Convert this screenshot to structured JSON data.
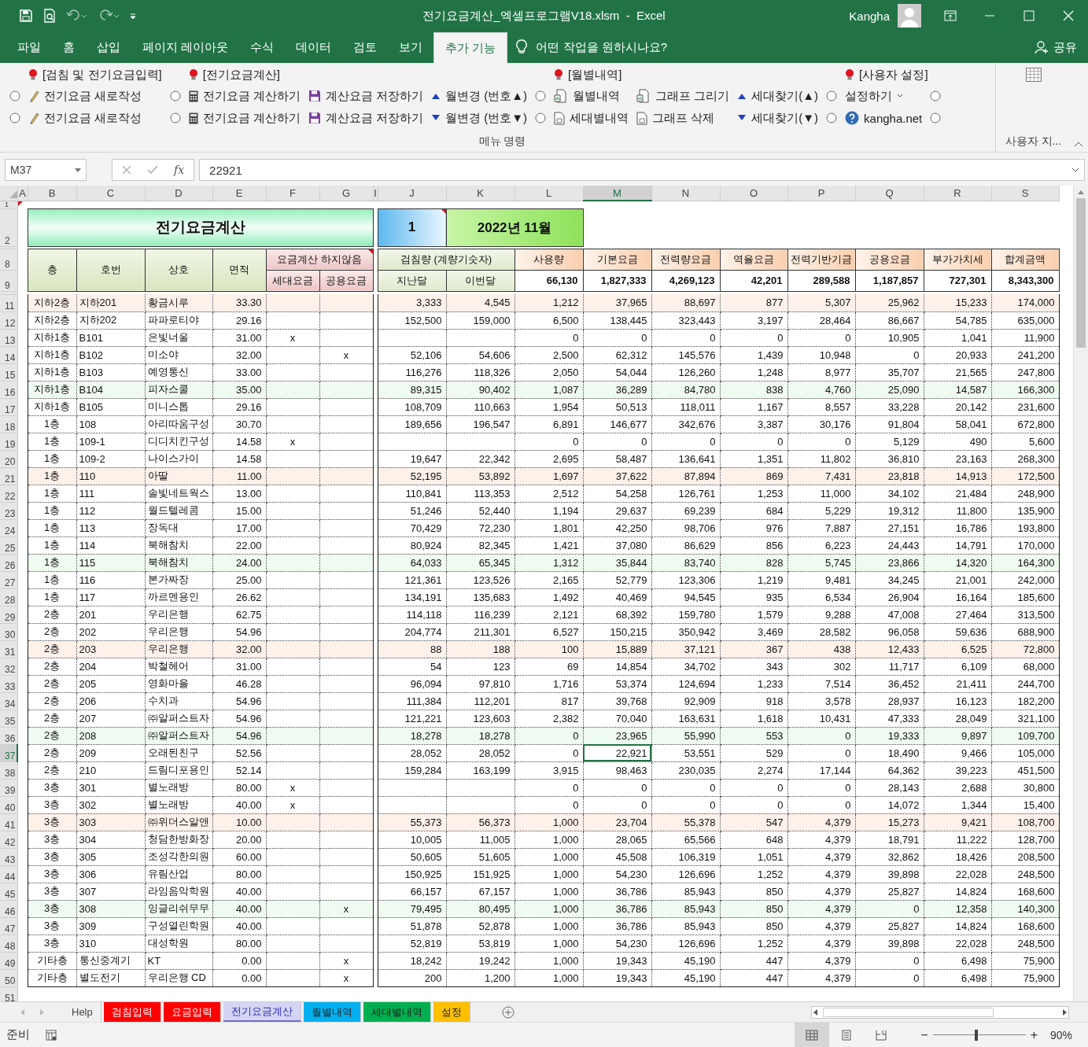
{
  "title_bar": {
    "title": "전기요금계산_엑셀프로그램V18.xlsm  -  Excel",
    "user": "Kangha"
  },
  "ribbon_tabs": [
    {
      "label": "파일",
      "selected": false
    },
    {
      "label": "홈",
      "selected": false
    },
    {
      "label": "삽입",
      "selected": false
    },
    {
      "label": "페이지 레이아웃",
      "selected": false
    },
    {
      "label": "수식",
      "selected": false
    },
    {
      "label": "데이터",
      "selected": false
    },
    {
      "label": "검토",
      "selected": false
    },
    {
      "label": "보기",
      "selected": false
    },
    {
      "label": "추가 기능",
      "selected": true
    }
  ],
  "tell_me": "어떤 작업을 원하시나요?",
  "share": "공유",
  "ribbon": {
    "group_label": "메뉴 명령",
    "sections": [
      {
        "heading": "[검침 및 전기요금입력]",
        "items": [
          {
            "kind": "radio",
            "selected": false
          },
          {
            "kind": "command",
            "label": "전기요금 새로작성"
          },
          {
            "kind": "radio",
            "selected": false
          },
          {
            "kind": "command",
            "label": "전기요금 새로작성"
          }
        ]
      },
      {
        "heading": "[전기요금계산]",
        "items": [
          {
            "kind": "radio",
            "selected": false
          },
          {
            "kind": "command",
            "label": "전기요금 계산하기"
          },
          {
            "kind": "command",
            "label": "계산요금 저장하기"
          },
          {
            "kind": "command",
            "label": "월변경 (번호▲)"
          },
          {
            "kind": "radio",
            "selected": false
          },
          {
            "kind": "command",
            "label": "전기요금 계산하기"
          },
          {
            "kind": "command",
            "label": "계산요금 저장하기"
          },
          {
            "kind": "command",
            "label": "월변경 (번호▼)"
          }
        ]
      },
      {
        "heading": "[월별내역]",
        "items": [
          {
            "kind": "radio",
            "selected": false
          },
          {
            "kind": "command",
            "label": "월별내역"
          },
          {
            "kind": "command",
            "label": "그래프 그리기"
          },
          {
            "kind": "command",
            "label": "세대찾기(▲)"
          },
          {
            "kind": "radio",
            "selected": false
          },
          {
            "kind": "command",
            "label": "세대별내역"
          },
          {
            "kind": "command",
            "label": "그래프 삭제"
          },
          {
            "kind": "command",
            "label": "세대찾기(▼)"
          }
        ]
      },
      {
        "heading": "[사용자 설정]",
        "items": [
          {
            "kind": "radio",
            "selected": false
          },
          {
            "kind": "command",
            "label": "설정하기",
            "dropdown": true
          },
          {
            "kind": "radio",
            "selected": false
          },
          {
            "kind": "radio",
            "selected": false
          },
          {
            "kind": "command",
            "label": "kangha.net"
          },
          {
            "kind": "radio",
            "selected": false
          }
        ]
      }
    ],
    "custom_group_label": "사용자 지..."
  },
  "formula_bar": {
    "name_box": "M37",
    "function_label": "fx",
    "value": "22921"
  },
  "sheet": {
    "columns": [
      {
        "label": "A",
        "selected": false
      },
      {
        "label": "B",
        "selected": false
      },
      {
        "label": "C",
        "selected": false
      },
      {
        "label": "D",
        "selected": false
      },
      {
        "label": "E",
        "selected": false
      },
      {
        "label": "F",
        "selected": false
      },
      {
        "label": "G",
        "selected": false
      },
      {
        "label": "I",
        "selected": false
      },
      {
        "label": "J",
        "selected": false
      },
      {
        "label": "K",
        "selected": false
      },
      {
        "label": "L",
        "selected": false
      },
      {
        "label": "M",
        "selected": true
      },
      {
        "label": "N",
        "selected": false
      },
      {
        "label": "O",
        "selected": false
      },
      {
        "label": "P",
        "selected": false
      },
      {
        "label": "Q",
        "selected": false
      },
      {
        "label": "R",
        "selected": false
      },
      {
        "label": "S",
        "selected": false
      }
    ],
    "top_row": {
      "row": "1",
      "note": true
    },
    "title_row": {
      "row": "2",
      "title": "전기요금계산",
      "number": "1",
      "number_note": true,
      "month": "2022년 11월"
    },
    "header": {
      "rows": [
        "8",
        "9"
      ],
      "floor": "층",
      "unit": "호번",
      "name": "상호",
      "area": "면적",
      "exclude": "요금계산 하지않음",
      "exclude_note": true,
      "exclude_sub": [
        "세대요금",
        "공용요금"
      ],
      "meter": "검침량 (계량기숫자)",
      "meter_sub": [
        "지난달",
        "이번달"
      ],
      "charges": [
        {
          "label": "사용량",
          "total": "66,130"
        },
        {
          "label": "기본요금",
          "total": "1,827,333"
        },
        {
          "label": "전력량요금",
          "total": "4,269,123"
        },
        {
          "label": "역율요금",
          "total": "42,201"
        },
        {
          "label": "전력기반기금",
          "total": "289,588"
        },
        {
          "label": "공용요금",
          "total": "1,187,857"
        },
        {
          "label": "부가가치세",
          "total": "727,301"
        },
        {
          "label": "합계금액",
          "total": "8,343,300"
        }
      ]
    },
    "rows": [
      {
        "row": "11",
        "selected": false,
        "cells": [
          "",
          "지하2층",
          "지하201",
          "황금시루",
          "33.30",
          "",
          "",
          "",
          "3,333",
          "4,545",
          "1,212",
          "37,965",
          "88,697",
          "877",
          "5,307",
          "25,962",
          "15,233",
          "174,000"
        ]
      },
      {
        "row": "12",
        "selected": false,
        "cells": [
          "",
          "지하2층",
          "지하202",
          "파파로티야",
          "29.16",
          "",
          "",
          "",
          "152,500",
          "159,000",
          "6,500",
          "138,445",
          "323,443",
          "3,197",
          "28,464",
          "86,667",
          "54,785",
          "635,000"
        ]
      },
      {
        "row": "13",
        "selected": false,
        "cells": [
          "",
          "지하1층",
          "B101",
          "은빛너울",
          "31.00",
          "x",
          "",
          "",
          "",
          "",
          "0",
          "0",
          "0",
          "0",
          "0",
          "10,905",
          "1,041",
          "11,900"
        ]
      },
      {
        "row": "14",
        "selected": false,
        "cells": [
          "",
          "지하1층",
          "B102",
          "미소야",
          "32.00",
          "",
          "x",
          "",
          "52,106",
          "54,606",
          "2,500",
          "62,312",
          "145,576",
          "1,439",
          "10,948",
          "0",
          "20,933",
          "241,200"
        ]
      },
      {
        "row": "15",
        "selected": false,
        "cells": [
          "",
          "지하1층",
          "B103",
          "예영통신",
          "33.00",
          "",
          "",
          "",
          "116,276",
          "118,326",
          "2,050",
          "54,044",
          "126,260",
          "1,248",
          "8,977",
          "35,707",
          "21,565",
          "247,800"
        ]
      },
      {
        "row": "16",
        "selected": false,
        "cells": [
          "",
          "지하1층",
          "B104",
          "피자스쿨",
          "35.00",
          "",
          "",
          "",
          "89,315",
          "90,402",
          "1,087",
          "36,289",
          "84,780",
          "838",
          "4,760",
          "25,090",
          "14,587",
          "166,300"
        ]
      },
      {
        "row": "17",
        "selected": false,
        "cells": [
          "",
          "지하1층",
          "B105",
          "미니스톱",
          "29.16",
          "",
          "",
          "",
          "108,709",
          "110,663",
          "1,954",
          "50,513",
          "118,011",
          "1,167",
          "8,557",
          "33,228",
          "20,142",
          "231,600"
        ]
      },
      {
        "row": "18",
        "selected": false,
        "cells": [
          "",
          "1층",
          "108",
          "아리따움구성",
          "30.70",
          "",
          "",
          "",
          "189,656",
          "196,547",
          "6,891",
          "146,677",
          "342,676",
          "3,387",
          "30,176",
          "91,804",
          "58,041",
          "672,800"
        ]
      },
      {
        "row": "19",
        "selected": false,
        "cells": [
          "",
          "1층",
          "109-1",
          "디디치킨구성",
          "14.58",
          "x",
          "",
          "",
          "",
          "",
          "0",
          "0",
          "0",
          "0",
          "0",
          "5,129",
          "490",
          "5,600"
        ]
      },
      {
        "row": "20",
        "selected": false,
        "cells": [
          "",
          "1층",
          "109-2",
          "나이스가이",
          "14.58",
          "",
          "",
          "",
          "19,647",
          "22,342",
          "2,695",
          "58,487",
          "136,641",
          "1,351",
          "11,802",
          "36,810",
          "23,163",
          "268,300"
        ]
      },
      {
        "row": "21",
        "selected": false,
        "cells": [
          "",
          "1층",
          "110",
          "아딸",
          "11.00",
          "",
          "",
          "",
          "52,195",
          "53,892",
          "1,697",
          "37,622",
          "87,894",
          "869",
          "7,431",
          "23,818",
          "14,913",
          "172,500"
        ]
      },
      {
        "row": "22",
        "selected": false,
        "cells": [
          "",
          "1층",
          "111",
          "솔빛네트웍스",
          "13.00",
          "",
          "",
          "",
          "110,841",
          "113,353",
          "2,512",
          "54,258",
          "126,761",
          "1,253",
          "11,000",
          "34,102",
          "21,484",
          "248,900"
        ]
      },
      {
        "row": "23",
        "selected": false,
        "cells": [
          "",
          "1층",
          "112",
          "월드텔레콤",
          "15.00",
          "",
          "",
          "",
          "51,246",
          "52,440",
          "1,194",
          "29,637",
          "69,239",
          "684",
          "5,229",
          "19,312",
          "11,800",
          "135,900"
        ]
      },
      {
        "row": "24",
        "selected": false,
        "cells": [
          "",
          "1층",
          "113",
          "장독대",
          "17.00",
          "",
          "",
          "",
          "70,429",
          "72,230",
          "1,801",
          "42,250",
          "98,706",
          "976",
          "7,887",
          "27,151",
          "16,786",
          "193,800"
        ]
      },
      {
        "row": "25",
        "selected": false,
        "cells": [
          "",
          "1층",
          "114",
          "북해참치",
          "22.00",
          "",
          "",
          "",
          "80,924",
          "82,345",
          "1,421",
          "37,080",
          "86,629",
          "856",
          "6,223",
          "24,443",
          "14,791",
          "170,000"
        ]
      },
      {
        "row": "26",
        "selected": false,
        "cells": [
          "",
          "1층",
          "115",
          "북해참치",
          "24.00",
          "",
          "",
          "",
          "64,033",
          "65,345",
          "1,312",
          "35,844",
          "83,740",
          "828",
          "5,745",
          "23,866",
          "14,320",
          "164,300"
        ]
      },
      {
        "row": "27",
        "selected": false,
        "cells": [
          "",
          "1층",
          "116",
          "본가짜장",
          "25.00",
          "",
          "",
          "",
          "121,361",
          "123,526",
          "2,165",
          "52,779",
          "123,306",
          "1,219",
          "9,481",
          "34,245",
          "21,001",
          "242,000"
        ]
      },
      {
        "row": "28",
        "selected": false,
        "cells": [
          "",
          "1층",
          "117",
          "까르멘용인",
          "26.62",
          "",
          "",
          "",
          "134,191",
          "135,683",
          "1,492",
          "40,469",
          "94,545",
          "935",
          "6,534",
          "26,904",
          "16,164",
          "185,600"
        ]
      },
      {
        "row": "29",
        "selected": false,
        "cells": [
          "",
          "2층",
          "201",
          "우리은행",
          "62.75",
          "",
          "",
          "",
          "114,118",
          "116,239",
          "2,121",
          "68,392",
          "159,780",
          "1,579",
          "9,288",
          "47,008",
          "27,464",
          "313,500"
        ]
      },
      {
        "row": "30",
        "selected": false,
        "cells": [
          "",
          "2층",
          "202",
          "우리은행",
          "54.96",
          "",
          "",
          "",
          "204,774",
          "211,301",
          "6,527",
          "150,215",
          "350,942",
          "3,469",
          "28,582",
          "96,058",
          "59,636",
          "688,900"
        ]
      },
      {
        "row": "31",
        "selected": false,
        "cells": [
          "",
          "2층",
          "203",
          "우리은행",
          "32.00",
          "",
          "",
          "",
          "88",
          "188",
          "100",
          "15,889",
          "37,121",
          "367",
          "438",
          "12,433",
          "6,525",
          "72,800"
        ]
      },
      {
        "row": "32",
        "selected": false,
        "cells": [
          "",
          "2층",
          "204",
          "박철헤어",
          "31.00",
          "",
          "",
          "",
          "54",
          "123",
          "69",
          "14,854",
          "34,702",
          "343",
          "302",
          "11,717",
          "6,109",
          "68,000"
        ]
      },
      {
        "row": "33",
        "selected": false,
        "cells": [
          "",
          "2층",
          "205",
          "영화마을",
          "46.28",
          "",
          "",
          "",
          "96,094",
          "97,810",
          "1,716",
          "53,374",
          "124,694",
          "1,233",
          "7,514",
          "36,452",
          "21,411",
          "244,700"
        ]
      },
      {
        "row": "34",
        "selected": false,
        "cells": [
          "",
          "2층",
          "206",
          "수치과",
          "54.96",
          "",
          "",
          "",
          "111,384",
          "112,201",
          "817",
          "39,768",
          "92,909",
          "918",
          "3,578",
          "28,937",
          "16,123",
          "182,200"
        ]
      },
      {
        "row": "35",
        "selected": false,
        "cells": [
          "",
          "2층",
          "207",
          "㈜알퍼스트자",
          "54.96",
          "",
          "",
          "",
          "121,221",
          "123,603",
          "2,382",
          "70,040",
          "163,631",
          "1,618",
          "10,431",
          "47,333",
          "28,049",
          "321,100"
        ]
      },
      {
        "row": "36",
        "selected": false,
        "cells": [
          "",
          "2층",
          "208",
          "㈜알퍼스트자",
          "54.96",
          "",
          "",
          "",
          "18,278",
          "18,278",
          "0",
          "23,965",
          "55,990",
          "553",
          "0",
          "19,333",
          "9,897",
          "109,700"
        ]
      },
      {
        "row": "37",
        "selected": true,
        "cells": [
          "",
          "2층",
          "209",
          "오래된친구",
          "52.56",
          "",
          "",
          "",
          "28,052",
          "28,052",
          "0",
          "22,921",
          "53,551",
          "529",
          "0",
          "18,490",
          "9,466",
          "105,000"
        ]
      },
      {
        "row": "38",
        "selected": false,
        "cells": [
          "",
          "2층",
          "210",
          "드림디포용인",
          "52.14",
          "",
          "",
          "",
          "159,284",
          "163,199",
          "3,915",
          "98,463",
          "230,035",
          "2,274",
          "17,144",
          "64,362",
          "39,223",
          "451,500"
        ]
      },
      {
        "row": "39",
        "selected": false,
        "cells": [
          "",
          "3층",
          "301",
          "별노래방",
          "80.00",
          "x",
          "",
          "",
          "",
          "",
          "0",
          "0",
          "0",
          "0",
          "0",
          "28,143",
          "2,688",
          "30,800"
        ]
      },
      {
        "row": "40",
        "selected": false,
        "cells": [
          "",
          "3층",
          "302",
          "별노래방",
          "40.00",
          "x",
          "",
          "",
          "",
          "",
          "0",
          "0",
          "0",
          "0",
          "0",
          "14,072",
          "1,344",
          "15,400"
        ]
      },
      {
        "row": "41",
        "selected": false,
        "cells": [
          "",
          "3층",
          "303",
          "㈜위더스알앤",
          "10.00",
          "",
          "",
          "",
          "55,373",
          "56,373",
          "1,000",
          "23,704",
          "55,378",
          "547",
          "4,379",
          "15,273",
          "9,421",
          "108,700"
        ]
      },
      {
        "row": "42",
        "selected": false,
        "cells": [
          "",
          "3층",
          "304",
          "청담한방화장",
          "20.00",
          "",
          "",
          "",
          "10,005",
          "11,005",
          "1,000",
          "28,065",
          "65,566",
          "648",
          "4,379",
          "18,791",
          "11,222",
          "128,700"
        ]
      },
      {
        "row": "43",
        "selected": false,
        "cells": [
          "",
          "3층",
          "305",
          "조성각한의원",
          "60.00",
          "",
          "",
          "",
          "50,605",
          "51,605",
          "1,000",
          "45,508",
          "106,319",
          "1,051",
          "4,379",
          "32,862",
          "18,426",
          "208,500"
        ]
      },
      {
        "row": "44",
        "selected": false,
        "cells": [
          "",
          "3층",
          "306",
          "유림산업",
          "80.00",
          "",
          "",
          "",
          "150,925",
          "151,925",
          "1,000",
          "54,230",
          "126,696",
          "1,252",
          "4,379",
          "39,898",
          "22,028",
          "248,500"
        ]
      },
      {
        "row": "45",
        "selected": false,
        "cells": [
          "",
          "3층",
          "307",
          "라임음악학원",
          "40.00",
          "",
          "",
          "",
          "66,157",
          "67,157",
          "1,000",
          "36,786",
          "85,943",
          "850",
          "4,379",
          "25,827",
          "14,824",
          "168,600"
        ]
      },
      {
        "row": "46",
        "selected": false,
        "cells": [
          "",
          "3층",
          "308",
          "잉글리쉬무무",
          "40.00",
          "",
          "x",
          "",
          "79,495",
          "80,495",
          "1,000",
          "36,786",
          "85,943",
          "850",
          "4,379",
          "0",
          "12,358",
          "140,300"
        ]
      },
      {
        "row": "47",
        "selected": false,
        "cells": [
          "",
          "3층",
          "309",
          "구성열린학원",
          "40.00",
          "",
          "",
          "",
          "51,878",
          "52,878",
          "1,000",
          "36,786",
          "85,943",
          "850",
          "4,379",
          "25,827",
          "14,824",
          "168,600"
        ]
      },
      {
        "row": "48",
        "selected": false,
        "cells": [
          "",
          "3층",
          "310",
          "대성학원",
          "80.00",
          "",
          "",
          "",
          "52,819",
          "53,819",
          "1,000",
          "54,230",
          "126,696",
          "1,252",
          "4,379",
          "39,898",
          "22,028",
          "248,500"
        ]
      },
      {
        "row": "49",
        "selected": false,
        "cells": [
          "",
          "기타층",
          "통신중계기",
          "KT",
          "0.00",
          "",
          "x",
          "",
          "18,242",
          "19,242",
          "1,000",
          "19,343",
          "45,190",
          "447",
          "4,379",
          "0",
          "6,498",
          "75,900"
        ]
      },
      {
        "row": "50",
        "selected": false,
        "cells": [
          "",
          "기타층",
          "별도전기",
          "우리은행 CD",
          "0.00",
          "",
          "x",
          "",
          "200",
          "1,200",
          "1,000",
          "19,343",
          "45,190",
          "447",
          "4,379",
          "0",
          "6,498",
          "75,900"
        ]
      }
    ],
    "last_row": "51"
  },
  "sheet_tabs": [
    {
      "label": "Help",
      "selected": false
    },
    {
      "label": "검침입력",
      "color": "#ff0000",
      "selected": false
    },
    {
      "label": "요금입력",
      "color": "#ff0000",
      "selected": false
    },
    {
      "label": "전기요금계산",
      "color": "#d4d4f4",
      "selected": true
    },
    {
      "label": "월별내역",
      "color": "#00b0f0",
      "selected": false
    },
    {
      "label": "세대별내역",
      "color": "#00b050",
      "selected": false
    },
    {
      "label": "설정",
      "color": "#ffc000",
      "selected": false
    }
  ],
  "status_bar": {
    "status": "준비",
    "views": [
      {
        "selected": true
      },
      {
        "selected": false
      },
      {
        "selected": false
      }
    ],
    "zoom_out": "−",
    "zoom_in": "+",
    "zoom": {
      "level": 0.47
    },
    "zoom_label": "90%"
  }
}
